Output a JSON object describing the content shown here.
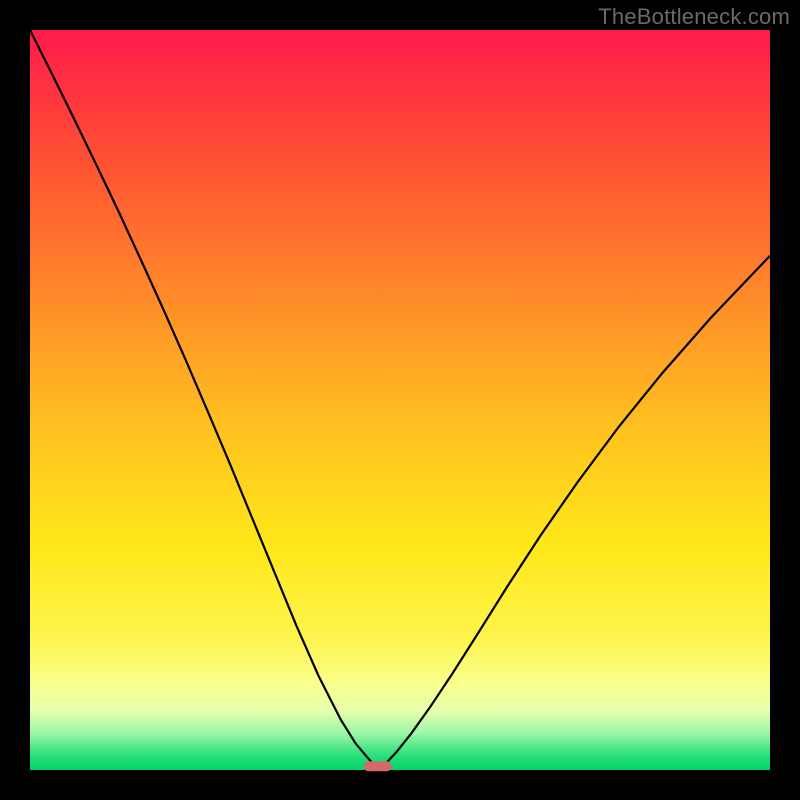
{
  "watermark": {
    "text": "TheBottleneck.com"
  },
  "chart_data": {
    "type": "line",
    "title": "",
    "xlabel": "",
    "ylabel": "",
    "xlim": [
      0,
      100
    ],
    "ylim": [
      0,
      100
    ],
    "grid": false,
    "legend": false,
    "background": "vertical gradient red→orange→yellow→green",
    "marker": {
      "x": 47,
      "y": 0.5,
      "color": "#d36a6a"
    },
    "series": [
      {
        "name": "left-branch",
        "x": [
          0,
          3,
          6,
          9,
          12,
          15,
          18,
          21,
          24,
          27,
          30,
          33,
          36,
          39,
          42,
          44,
          45.5,
          46.5,
          47
        ],
        "y": [
          100,
          94.0,
          87.9,
          81.7,
          75.4,
          68.9,
          62.3,
          55.5,
          48.5,
          41.4,
          34.1,
          26.8,
          19.5,
          12.7,
          6.8,
          3.6,
          1.8,
          0.7,
          0.0
        ]
      },
      {
        "name": "right-branch",
        "x": [
          47,
          48,
          49.5,
          51.5,
          54,
          57,
          60.5,
          64.5,
          69,
          74,
          79.5,
          85.5,
          92,
          100
        ],
        "y": [
          0.0,
          0.8,
          2.4,
          4.9,
          8.4,
          12.9,
          18.4,
          24.8,
          31.7,
          38.9,
          46.3,
          53.7,
          61.1,
          69.5
        ]
      }
    ]
  }
}
